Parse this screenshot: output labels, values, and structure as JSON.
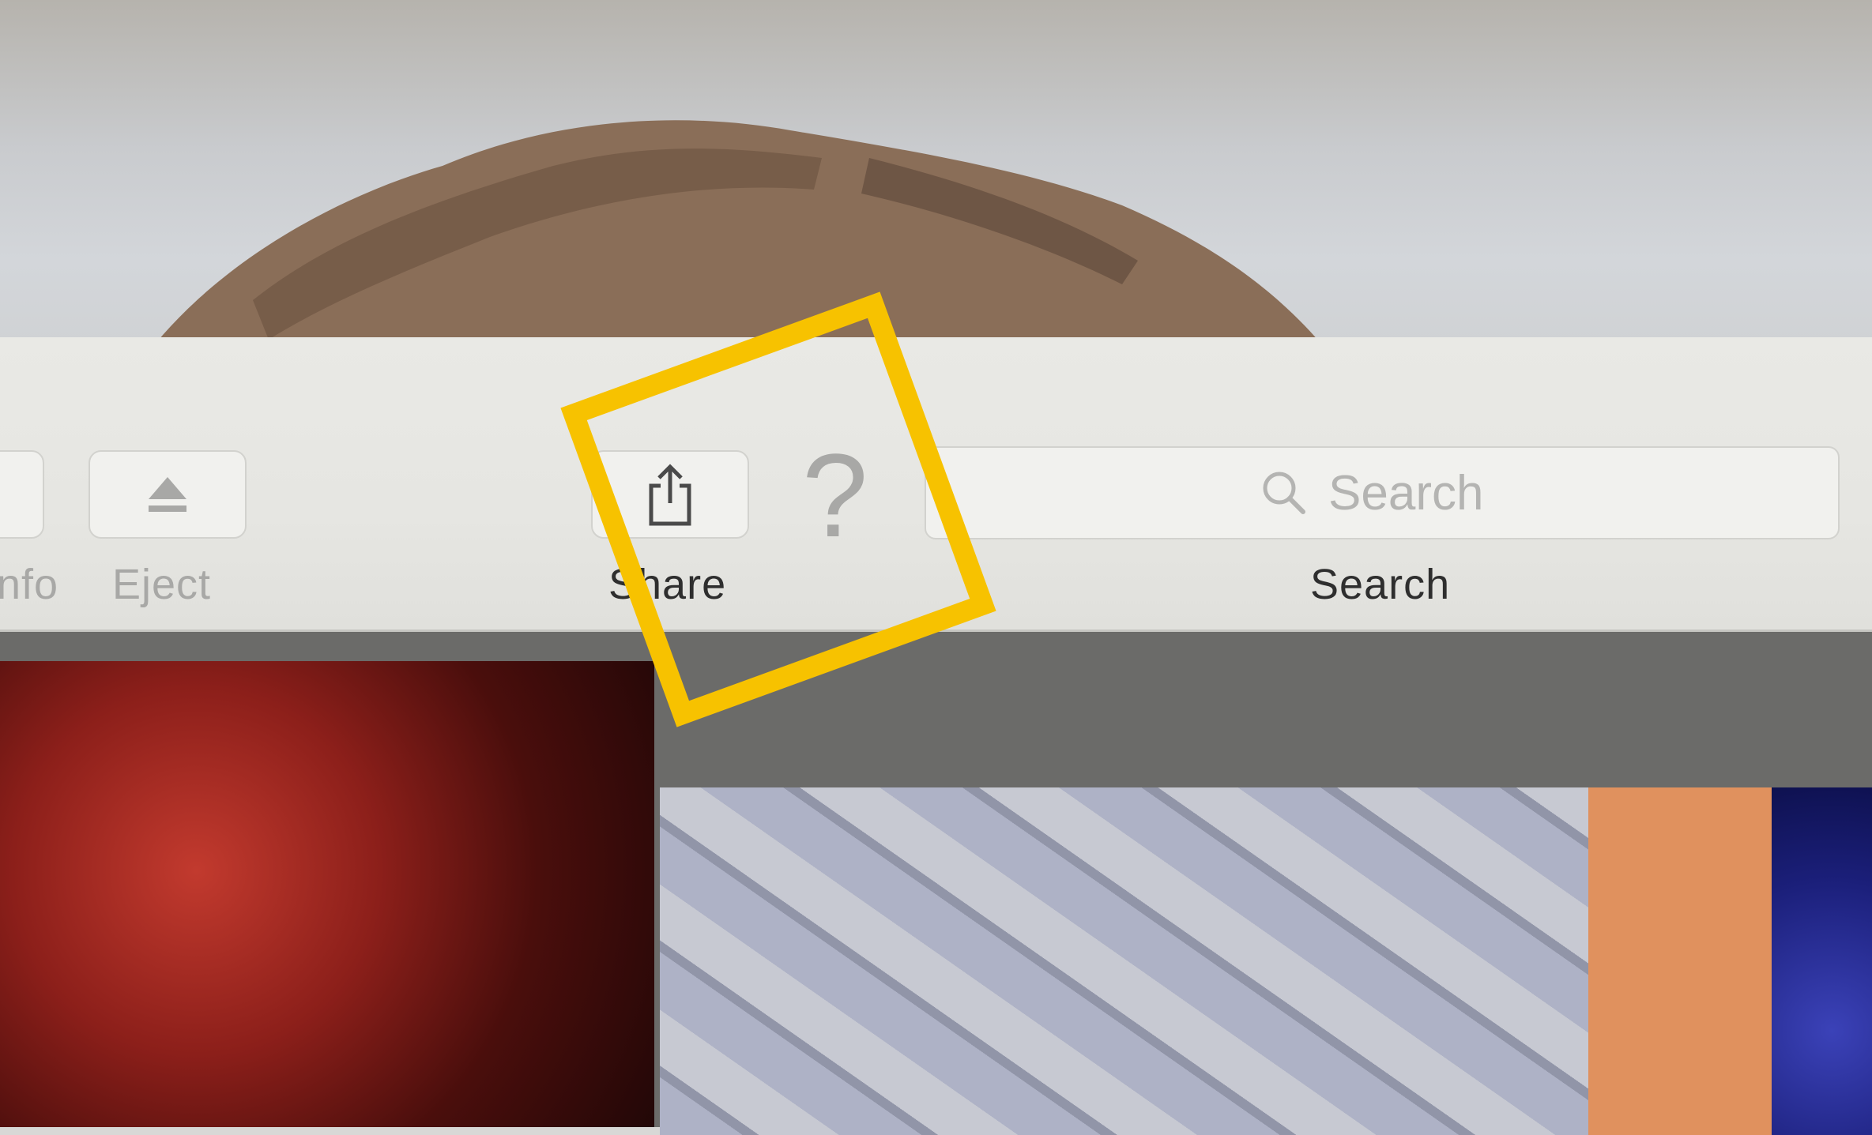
{
  "toolbar": {
    "info_label": "nfo",
    "eject_label": "Eject",
    "share_label": "Share",
    "help_glyph": "?",
    "search_placeholder": "Search",
    "search_label": "Search"
  },
  "icons": {
    "eject": "eject-icon",
    "share": "share-icon",
    "help": "help-icon",
    "search": "magnifier-icon"
  },
  "colors": {
    "highlight": "#f7c200",
    "toolbar_bg": "#e8e8e4"
  }
}
